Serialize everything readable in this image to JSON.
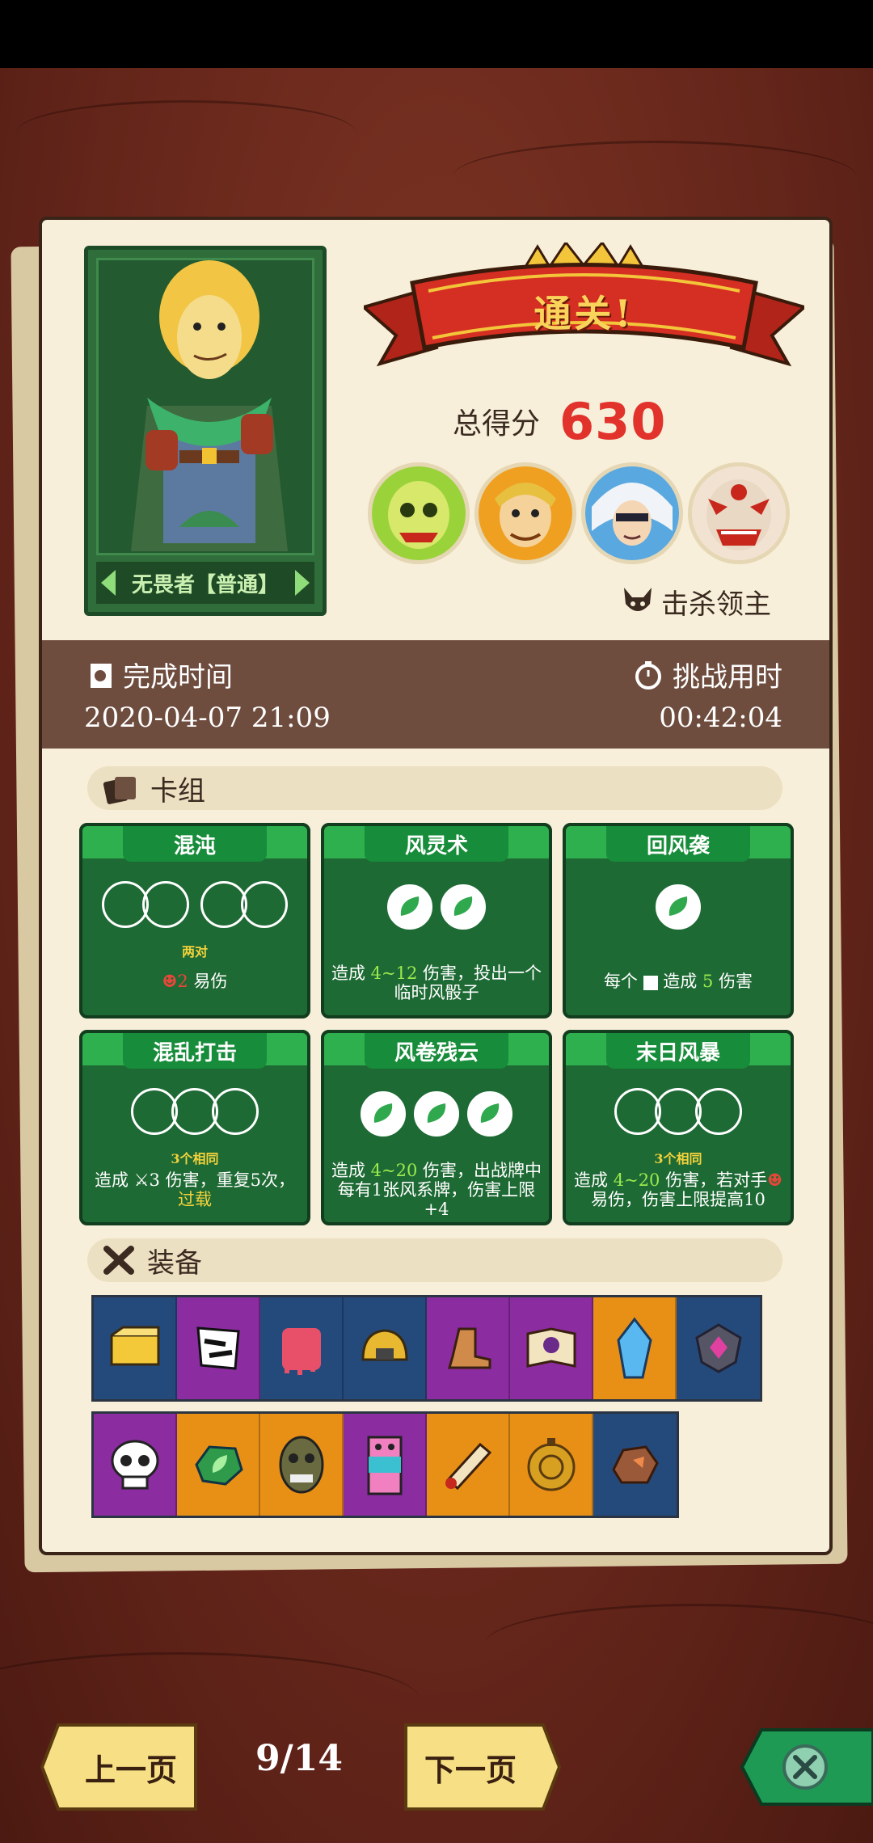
{
  "result": {
    "banner": "通关!",
    "score_label": "总得分",
    "score_value": "630",
    "kill_label": "击杀领主",
    "hero_label": "无畏者【普通】"
  },
  "time": {
    "complete_label": "完成时间",
    "complete_value": "2020-04-07 21:09",
    "challenge_label": "挑战用时",
    "challenge_value": "00:42:04"
  },
  "deck": {
    "title": "卡组",
    "cards": [
      {
        "name": "混沌",
        "dice_sub": "两对",
        "desc_pre": "",
        "desc_num": "2",
        "desc_post": " 易伤"
      },
      {
        "name": "风灵术",
        "dice_sub": "",
        "desc_pre": "造成 ",
        "desc_range": "4~12",
        "desc_post": " 伤害，投出一个临时风骰子"
      },
      {
        "name": "回风袭",
        "dice_sub": "",
        "desc_pre": "每个 ",
        "desc_mid": " 造成 ",
        "desc_num": "5",
        "desc_post": " 伤害"
      },
      {
        "name": "混乱打击",
        "dice_sub": "3个相同",
        "desc_pre": "造成 ",
        "desc_num": "3",
        "desc_post": " 伤害，重复5次，",
        "desc_kw": "过载"
      },
      {
        "name": "风卷残云",
        "dice_sub": "",
        "desc_pre": "造成 ",
        "desc_range": "4~20",
        "desc_post": " 伤害，出战牌中每有1张风系牌，伤害上限+4"
      },
      {
        "name": "末日风暴",
        "dice_sub": "3个相同",
        "desc_pre": "造成 ",
        "desc_range": "4~20",
        "desc_post": " 伤害，若对手",
        "desc_post2": "易伤，伤害上限提高10"
      }
    ]
  },
  "equipment": {
    "title": "装备",
    "row1": [
      "gold-bars-icon",
      "torn-cloth-icon",
      "jelly-cube-icon",
      "golden-helmet-icon",
      "boots-icon",
      "skull-book-icon",
      "crystal-icon",
      "purple-gem-shield-icon"
    ],
    "row2": [
      "skull-icon",
      "wind-stone-icon",
      "mask-icon",
      "totem-icon",
      "scroll-icon",
      "compass-medal-icon",
      "ore-rock-icon"
    ],
    "row1_colors": [
      "blue",
      "purple",
      "blue",
      "blue",
      "purple",
      "purple",
      "orange",
      "blue"
    ],
    "row2_colors": [
      "purple",
      "orange",
      "orange",
      "purple",
      "orange",
      "orange",
      "blue"
    ]
  },
  "nav": {
    "prev": "上一页",
    "page": "9/14",
    "next": "下一页"
  },
  "colors": {
    "score": "#e2322c",
    "card_green": "#1e6a34",
    "banner_red": "#c8281c",
    "time_bar": "#6e4c3e"
  }
}
